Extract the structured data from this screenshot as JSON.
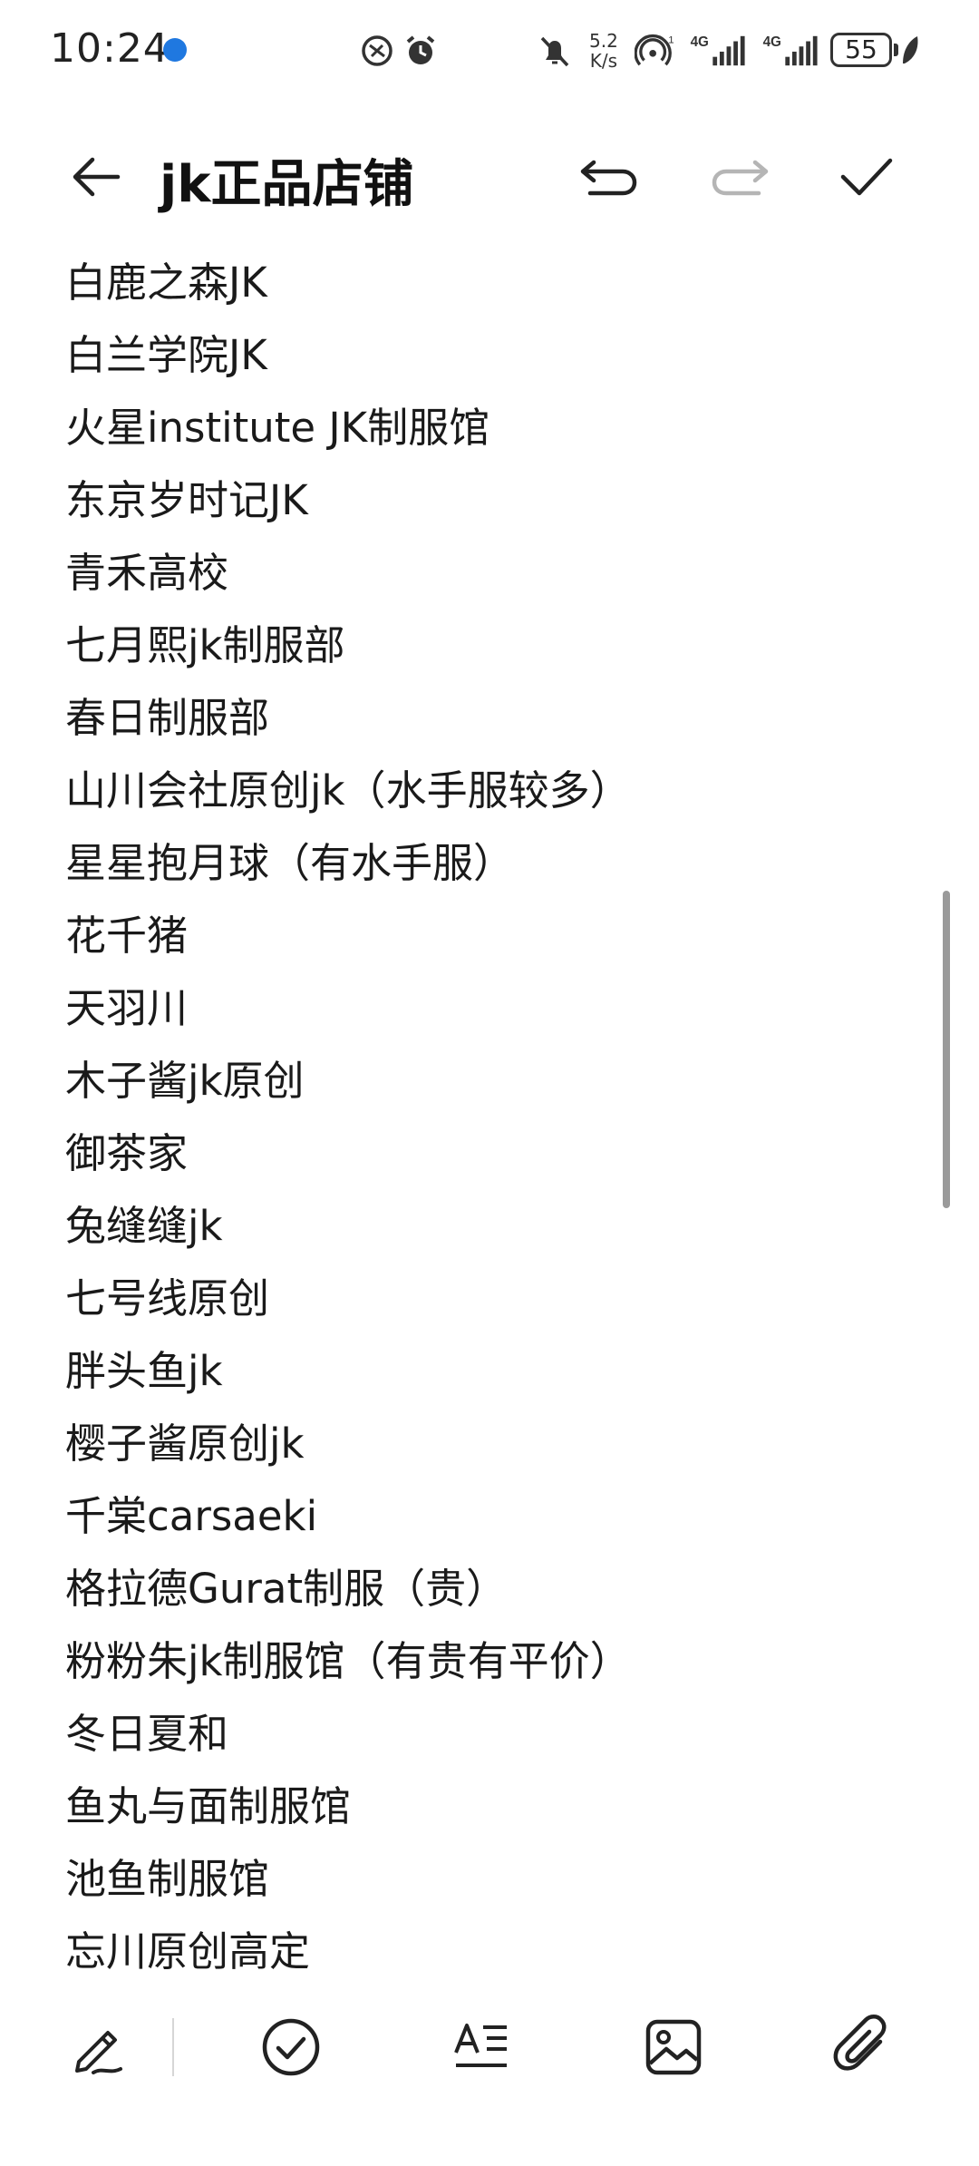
{
  "status_bar": {
    "time": "10:24",
    "net_speed_value": "5.2",
    "net_speed_unit": "K/s",
    "signal_label_1": "4G",
    "signal_label_2": "4G",
    "battery": "55"
  },
  "header": {
    "title": "jk正品店铺"
  },
  "note": {
    "lines": [
      "白鹿之森JK",
      "白兰学院JK",
      "火星institute  JK制服馆",
      "东京岁时记JK",
      "青禾高校",
      "七月熙jk制服部",
      "春日制服部",
      "山川会社原创jk（水手服较多）",
      "星星抱月球（有水手服）",
      "花千猪",
      "天羽川",
      "木子酱jk原创",
      "御茶家",
      "兔缝缝jk",
      "七号线原创",
      "胖头鱼jk",
      "樱子酱原创jk",
      "千棠carsaeki",
      "格拉德Gurat制服（贵）",
      "粉粉朱jk制服馆（有贵有平价）",
      "冬日夏和",
      "鱼丸与面制服馆",
      "池鱼制服馆",
      "忘川原创高定"
    ]
  },
  "toolbar": {
    "icons": [
      "pen-icon",
      "checklist-icon",
      "text-style-icon",
      "image-icon",
      "attachment-icon"
    ]
  },
  "colors": {
    "text": "#1a1a1a",
    "icon": "#222222",
    "disabled_icon": "#b5b5b5",
    "status_dot": "#1f78e0"
  }
}
